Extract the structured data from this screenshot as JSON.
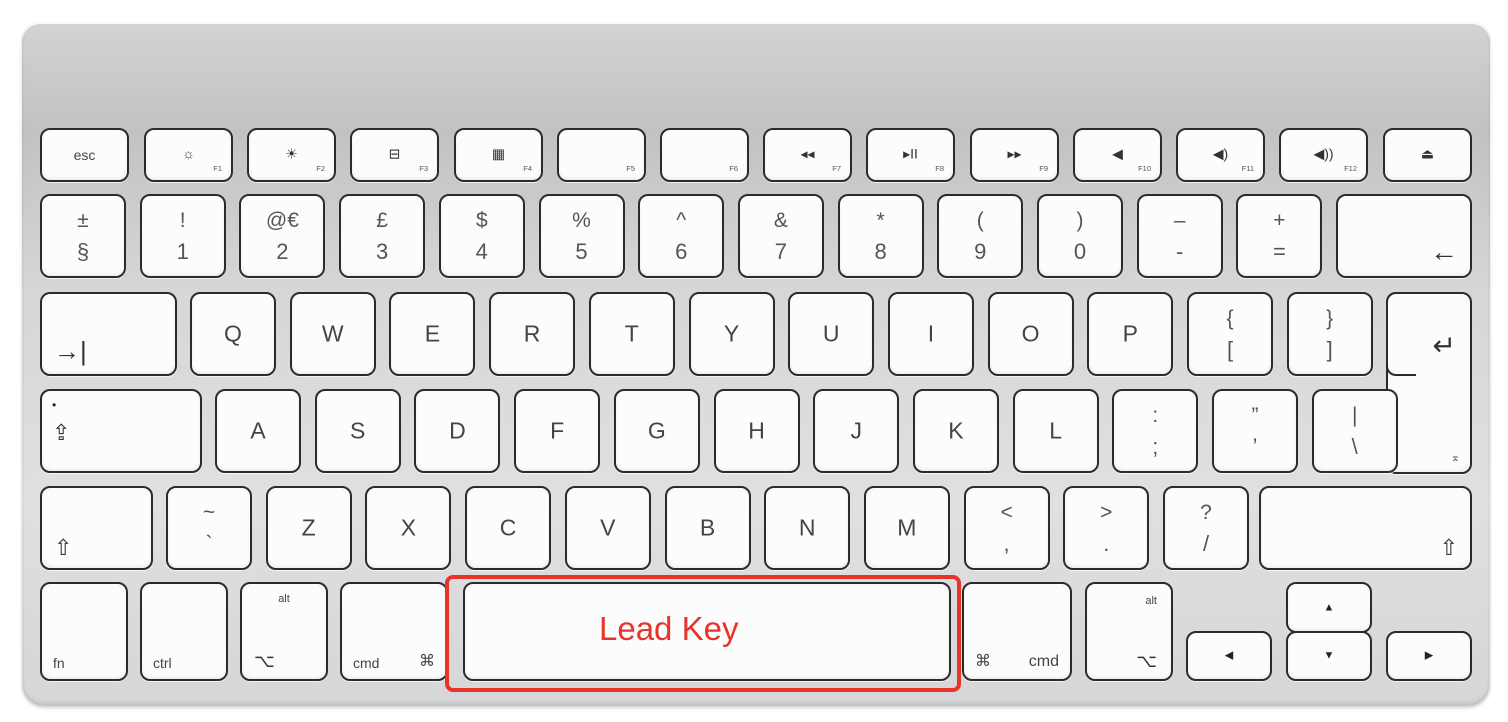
{
  "keyboard": {
    "rows": [
      [
        {
          "id": "esc",
          "main": "esc"
        },
        {
          "id": "f1",
          "icon": "☼",
          "fnum": "F1",
          "icon_name": "brightness-down-icon"
        },
        {
          "id": "f2",
          "icon": "☀",
          "fnum": "F2",
          "icon_name": "brightness-up-icon"
        },
        {
          "id": "f3",
          "icon": "⊟",
          "fnum": "F3",
          "icon_name": "expose-icon"
        },
        {
          "id": "f4",
          "icon": "▦",
          "fnum": "F4",
          "icon_name": "dashboard-icon"
        },
        {
          "id": "f5",
          "fnum": "F5"
        },
        {
          "id": "f6",
          "fnum": "F6"
        },
        {
          "id": "f7",
          "icon": "◂◂",
          "fnum": "F7",
          "icon_name": "rewind-icon"
        },
        {
          "id": "f8",
          "icon": "▸II",
          "fnum": "F8",
          "icon_name": "play-pause-icon"
        },
        {
          "id": "f9",
          "icon": "▸▸",
          "fnum": "F9",
          "icon_name": "fast-forward-icon"
        },
        {
          "id": "f10",
          "icon": "◀",
          "fnum": "F10",
          "icon_name": "mute-icon"
        },
        {
          "id": "f11",
          "icon": "◀)",
          "fnum": "F11",
          "icon_name": "volume-down-icon"
        },
        {
          "id": "f12",
          "icon": "◀))",
          "fnum": "F12",
          "icon_name": "volume-up-icon"
        },
        {
          "id": "eject",
          "icon": "⏏",
          "icon_name": "eject-icon"
        }
      ],
      [
        {
          "id": "section",
          "top": "±",
          "bot": "§"
        },
        {
          "id": "1",
          "top": "!",
          "bot": "1"
        },
        {
          "id": "2",
          "top": "@€",
          "bot": "2"
        },
        {
          "id": "3",
          "top": "£",
          "bot": "3"
        },
        {
          "id": "4",
          "top": "$",
          "bot": "4"
        },
        {
          "id": "5",
          "top": "%",
          "bot": "5"
        },
        {
          "id": "6",
          "top": "^",
          "bot": "6"
        },
        {
          "id": "7",
          "top": "&",
          "bot": "7"
        },
        {
          "id": "8",
          "top": "*",
          "bot": "8"
        },
        {
          "id": "9",
          "top": "(",
          "bot": "9"
        },
        {
          "id": "0",
          "top": ")",
          "bot": "0"
        },
        {
          "id": "minus",
          "top": "–",
          "bot": "-"
        },
        {
          "id": "equals",
          "top": "+",
          "bot": "="
        },
        {
          "id": "backspace",
          "icon": "←",
          "icon_name": "backspace-icon"
        }
      ],
      [
        {
          "id": "tab",
          "icon": "→|",
          "icon_name": "tab-icon"
        },
        {
          "id": "q",
          "main": "Q"
        },
        {
          "id": "w",
          "main": "W"
        },
        {
          "id": "e",
          "main": "E"
        },
        {
          "id": "r",
          "main": "R"
        },
        {
          "id": "t",
          "main": "T"
        },
        {
          "id": "y",
          "main": "Y"
        },
        {
          "id": "u",
          "main": "U"
        },
        {
          "id": "i",
          "main": "I"
        },
        {
          "id": "o",
          "main": "O"
        },
        {
          "id": "p",
          "main": "P"
        },
        {
          "id": "lbracket",
          "top": "{",
          "bot": "["
        },
        {
          "id": "rbracket",
          "top": "}",
          "bot": "]"
        }
      ],
      [
        {
          "id": "capslock",
          "icon": "⇪",
          "icon_name": "caps-lock-icon"
        },
        {
          "id": "a",
          "main": "A"
        },
        {
          "id": "s",
          "main": "S"
        },
        {
          "id": "d",
          "main": "D"
        },
        {
          "id": "f",
          "main": "F"
        },
        {
          "id": "g",
          "main": "G"
        },
        {
          "id": "h",
          "main": "H"
        },
        {
          "id": "j",
          "main": "J"
        },
        {
          "id": "k",
          "main": "K"
        },
        {
          "id": "l",
          "main": "L"
        },
        {
          "id": "semicolon",
          "top": ":",
          "bot": ";"
        },
        {
          "id": "quote",
          "top": "”",
          "bot": "’"
        },
        {
          "id": "backslash",
          "top": "|",
          "bot": "\\"
        }
      ],
      [
        {
          "id": "lshift",
          "icon": "⇧",
          "icon_name": "shift-icon"
        },
        {
          "id": "tilde",
          "top": "~",
          "bot": "`"
        },
        {
          "id": "z",
          "main": "Z"
        },
        {
          "id": "x",
          "main": "X"
        },
        {
          "id": "c",
          "main": "C"
        },
        {
          "id": "v",
          "main": "V"
        },
        {
          "id": "b",
          "main": "B"
        },
        {
          "id": "n",
          "main": "N"
        },
        {
          "id": "m",
          "main": "M"
        },
        {
          "id": "comma",
          "top": "<",
          "bot": ","
        },
        {
          "id": "period",
          "top": ">",
          "bot": "."
        },
        {
          "id": "slash",
          "top": "?",
          "bot": "/"
        },
        {
          "id": "rshift",
          "icon": "⇧",
          "icon_name": "shift-icon"
        }
      ]
    ],
    "return_key": {
      "icon": "↵",
      "small": "⌅",
      "icon_name": "return-icon"
    },
    "bottom_row": {
      "fn": "fn",
      "ctrl": "ctrl",
      "alt": "alt",
      "option_symbol": "⌥",
      "cmd": "cmd",
      "cmd_symbol": "⌘",
      "arrow_up": "▲",
      "arrow_down": "▼",
      "arrow_left": "◀",
      "arrow_right": "▶"
    }
  },
  "annotation": {
    "label": "Lead Key",
    "color": "#e8332b",
    "target_key": "space"
  }
}
